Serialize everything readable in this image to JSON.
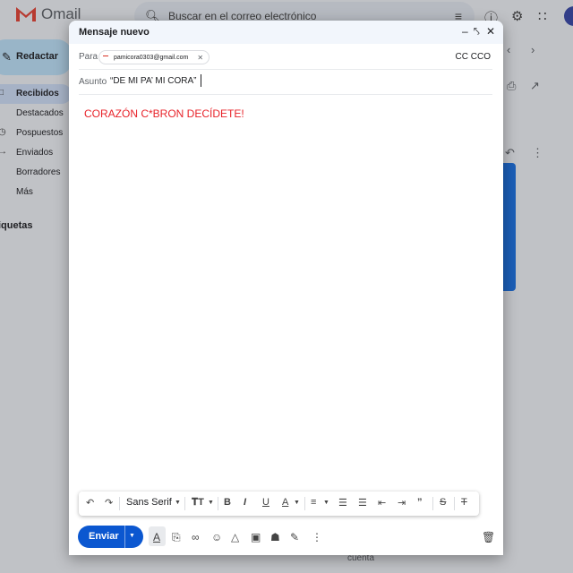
{
  "app": {
    "name": "Omail"
  },
  "search": {
    "placeholder": "Buscar en el correo electrónico"
  },
  "sidebar": {
    "compose_label": "Redactar",
    "items": [
      {
        "label": "Recibidos",
        "active": true
      },
      {
        "label": "Destacados"
      },
      {
        "label": "Pospuestos"
      },
      {
        "label": "Enviados"
      },
      {
        "label": "Borradores"
      },
      {
        "label": "Más"
      }
    ],
    "labels_heading": "iquetas"
  },
  "background": {
    "footer_text": "cuenta"
  },
  "compose": {
    "title": "Mensaje nuevo",
    "to_label": "Para",
    "recipient": "pamicora0303@gmail.com",
    "cc_label": "CC CCO",
    "subject_label": "Asunto",
    "subject_value": "“DE MI PA’ MI CORA”",
    "body_text": "CORAZÓN C*BRON DECÍDETE!",
    "body_color": "#e8232a",
    "font_name": "Sans Serif",
    "send_label": "Enviar"
  },
  "colors": {
    "accent": "#0b57d0",
    "compose_bg": "#c2e7ff",
    "header_bg": "#f2f6fc"
  }
}
